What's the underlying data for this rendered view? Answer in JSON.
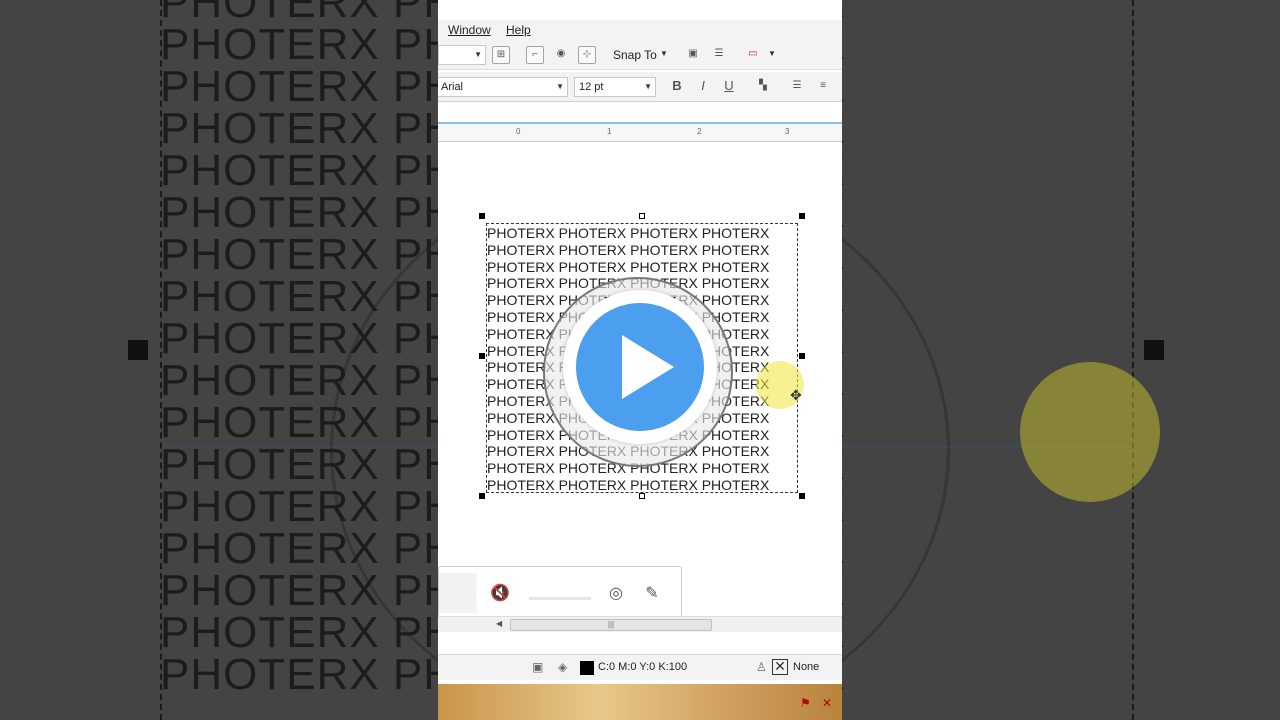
{
  "background": {
    "text_line": "PHOTERX PHOTERX PHOTERX",
    "lines_count_visible": 17
  },
  "menu": {
    "window": "Window",
    "help": "Help"
  },
  "toolbar": {
    "snap_to": "Snap To"
  },
  "text_props": {
    "font_name": "Arial",
    "font_size": "12 pt"
  },
  "ruler": {
    "ticks": [
      "0",
      "1",
      "2",
      "3"
    ]
  },
  "canvas": {
    "lines": [
      "PHOTERX PHOTERX PHOTERX PHOTERX",
      "PHOTERX PHOTERX PHOTERX PHOTERX",
      "PHOTERX PHOTERX PHOTERX PHOTERX",
      "PHOTERX PHOTERX PHOTERX PHOTERX",
      "PHOTERX PHOTERX PHOTERX PHOTERX",
      "PHOTERX PHOTERX PHOTERX PHOTERX",
      "PHOTERX PHOTERX PHOTERX PHOTERX",
      "PHOTERX PHOTERX PHOTERX PHOTERX",
      "PHOTERX PHOTERX PHOTERX PHOTERX",
      "PHOTERX PHOTERX PHOTERX PHOTERX",
      "PHOTERX PHOTERX PHOTERX PHOTERX",
      "PHOTERX PHOTERX PHOTERX PHOTERX",
      "PHOTERX PHOTERX PHOTERX PHOTERX",
      "PHOTERX PHOTERX PHOTERX PHOTERX",
      "PHOTERX PHOTERX PHOTERX PHOTERX",
      "PHOTERX PHOTERX PHOTERX PHOTERX"
    ],
    "sphere_lines": [
      "PHOTERX",
      "PHOTERX PHO",
      "PHOTERX PHOTER",
      "PHOTERX PHOTERX",
      "PHOTERX PHOTER",
      "PHOTERX PHO",
      "PHOTERX"
    ]
  },
  "status": {
    "color_text": "C:0 M:0 Y:0 K:100",
    "outline_text": "None"
  },
  "colors": {
    "play_button": "#4c9fef",
    "highlight": "#f0e63c",
    "fill_swatch": "#000000"
  },
  "icons": {
    "font_dropdown": "chevron-down-icon",
    "bold": "bold-icon",
    "italic": "italic-icon",
    "underline": "underline-icon",
    "bullets": "bullet-list-icon",
    "mute": "speaker-mute-icon",
    "webcam": "webcam-icon",
    "pen": "pencil-icon",
    "play": "play-icon",
    "outline_none": "cross-icon"
  }
}
